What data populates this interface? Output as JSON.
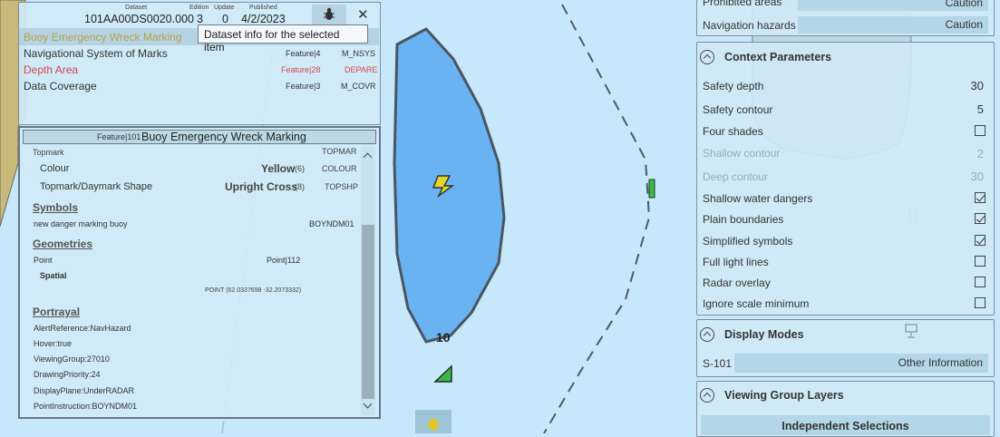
{
  "dataset_header": {
    "dataset_label": "Dataset",
    "dataset_value": "101AA00DS0020.000",
    "edition_label": "Edition",
    "edition_value": "3",
    "update_label": "Update",
    "update_value": "0",
    "published_label": "Published",
    "published_value": "4/2/2023",
    "bug_icon": "bug-icon",
    "close_icon": "close-icon",
    "close_glyph": "✕"
  },
  "tooltip": "Dataset info for the selected item",
  "feature_list": [
    {
      "name": "Buoy Emergency Wreck Marking",
      "feature": "",
      "code": "",
      "color": "#b5a24a"
    },
    {
      "name": "Navigational System of Marks",
      "feature": "Feature|4",
      "code": "M_NSYS",
      "color": "#333333"
    },
    {
      "name": "Depth Area",
      "feature": "Feature|28",
      "code": "DEPARE",
      "color": "#d9434f"
    },
    {
      "name": "Data Coverage",
      "feature": "Feature|3",
      "code": "M_COVR",
      "color": "#333333"
    }
  ],
  "detail": {
    "feature_id": "Feature|101",
    "title": "Buoy Emergency Wreck Marking",
    "topmark_label": "Topmark",
    "topmark_code": "TOPMAR",
    "colour_label": "Colour",
    "colour_value": "Yellow",
    "colour_num": "(6)",
    "colour_code": "COLOUR",
    "shape_label": "Topmark/Daymark Shape",
    "shape_value": "Upright Cross",
    "shape_num": "(8)",
    "shape_code": "TOPSHP",
    "symbols_heading": "Symbols",
    "symbol_desc": "new danger marking buoy",
    "symbol_code": "BOYNDM01",
    "geometries_heading": "Geometries",
    "point_label": "Point",
    "point_value": "Point|112",
    "spatial_label": "Spatial",
    "point_coords": "POINT (62.0337698 -32.2073332)",
    "portrayal_heading": "Portrayal",
    "portrayal": [
      "AlertReference:NavHazard",
      "Hover:true",
      "ViewingGroup:27010",
      "DrawingPriority:24",
      "DisplayPlane:UnderRADAR",
      "PointInstruction:BOYNDM01"
    ]
  },
  "map": {
    "sounding_label": "10",
    "buoy_icon": "emergency-wreck-buoy-icon",
    "arrow_icon": "arrow-down-icon"
  },
  "right_panel": {
    "top_rows": [
      {
        "label": "Prohibited areas",
        "value": "Caution"
      },
      {
        "label": "Navigation hazards",
        "value": "Caution"
      }
    ],
    "context": {
      "title": "Context Parameters",
      "safety_depth_label": "Safety depth",
      "safety_depth_value": "30",
      "safety_contour_label": "Safety contour",
      "safety_contour_value": "5",
      "four_shades_label": "Four shades",
      "shallow_contour_label": "Shallow contour",
      "shallow_contour_value": "2",
      "deep_contour_label": "Deep contour",
      "deep_contour_value": "30",
      "checkboxes": [
        {
          "label": "Shallow water dangers",
          "checked": true
        },
        {
          "label": "Plain boundaries",
          "checked": true
        },
        {
          "label": "Simplified symbols",
          "checked": true
        },
        {
          "label": "Full light lines",
          "checked": false
        },
        {
          "label": "Radar overlay",
          "checked": false
        },
        {
          "label": "Ignore scale minimum",
          "checked": false
        }
      ]
    },
    "display_modes": {
      "title": "Display Modes",
      "standard_label": "S-101",
      "mode_value": "Other Information",
      "monitor_icon": "monitor-icon"
    },
    "viewing_groups": {
      "title": "Viewing Group Layers",
      "button_label": "Independent Selections"
    }
  }
}
